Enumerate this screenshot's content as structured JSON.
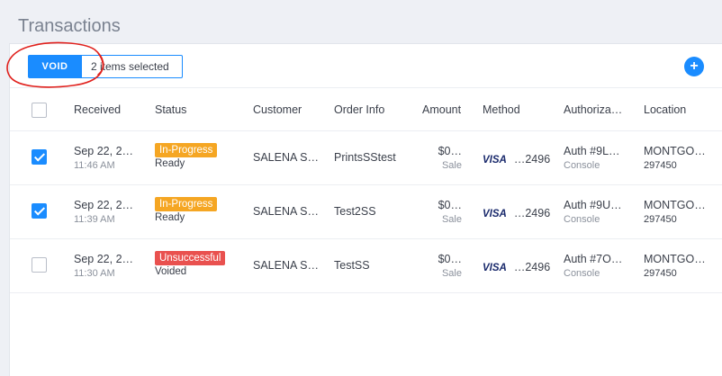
{
  "page": {
    "title": "Transactions"
  },
  "toolbar": {
    "void_label": "VOID",
    "selection_text": "2 items selected",
    "add_label": "+"
  },
  "table": {
    "columns": [
      "Received",
      "Status",
      "Customer",
      "Order Info",
      "Amount",
      "Method",
      "Authoriza…",
      "Location"
    ],
    "rows": [
      {
        "checked": true,
        "date": "Sep 22, 2…",
        "time": "11:46 AM",
        "status": "In-Progress",
        "status_sub": "Ready",
        "customer": "SALENA S…",
        "order": "PrintsSStest",
        "amount": "$0…",
        "amount_sub": "Sale",
        "card_brand": "VISA",
        "card_last": "…2496",
        "auth": "Auth #9L…",
        "auth_sub": "Console",
        "location": "MONTGO…",
        "location_sub": "297450"
      },
      {
        "checked": true,
        "date": "Sep 22, 2…",
        "time": "11:39 AM",
        "status": "In-Progress",
        "status_sub": "Ready",
        "customer": "SALENA S…",
        "order": "Test2SS",
        "amount": "$0…",
        "amount_sub": "Sale",
        "card_brand": "VISA",
        "card_last": "…2496",
        "auth": "Auth #9U…",
        "auth_sub": "Console",
        "location": "MONTGO…",
        "location_sub": "297450"
      },
      {
        "checked": false,
        "date": "Sep 22, 2…",
        "time": "11:30 AM",
        "status": "Unsuccessful",
        "status_sub": "Voided",
        "customer": "SALENA S…",
        "order": "TestSS",
        "amount": "$0…",
        "amount_sub": "Sale",
        "card_brand": "VISA",
        "card_last": "…2496",
        "auth": "Auth #7O…",
        "auth_sub": "Console",
        "location": "MONTGO…",
        "location_sub": "297450"
      }
    ]
  },
  "colors": {
    "accent": "#1a8cff",
    "in_progress": "#f5a623",
    "unsuccessful": "#e9514f",
    "annotation": "#e0201c"
  }
}
